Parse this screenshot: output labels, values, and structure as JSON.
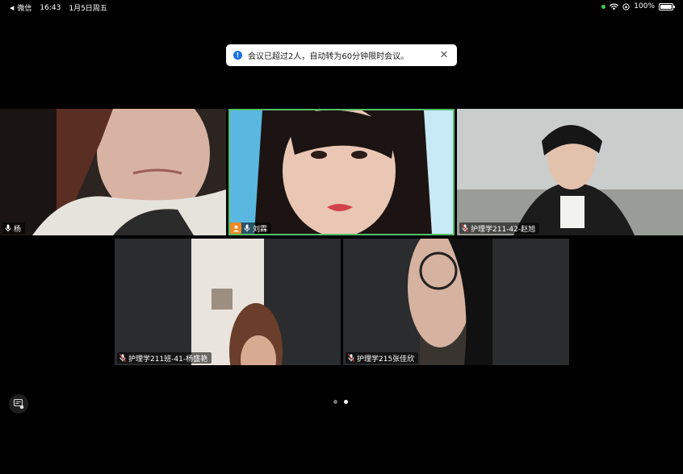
{
  "status_bar": {
    "back_app": "微信",
    "time": "16:43",
    "date": "1月5日周五",
    "battery": "100%"
  },
  "toast": {
    "message": "会议已超过2人，自动转为60分钟限时会议。"
  },
  "participants": [
    {
      "name": "杨"
    },
    {
      "name": "刘霖"
    },
    {
      "name": "护理学211-42-赵旭"
    },
    {
      "name": "护理学211班-41-杨盛艳"
    },
    {
      "name": "护理学215张佳欣"
    }
  ],
  "pager": {
    "total": 2,
    "current": 2
  },
  "colors": {
    "active_speaker_border": "#55c06a",
    "host_badge": "#f08a24",
    "toast_info": "#1a73e8"
  }
}
